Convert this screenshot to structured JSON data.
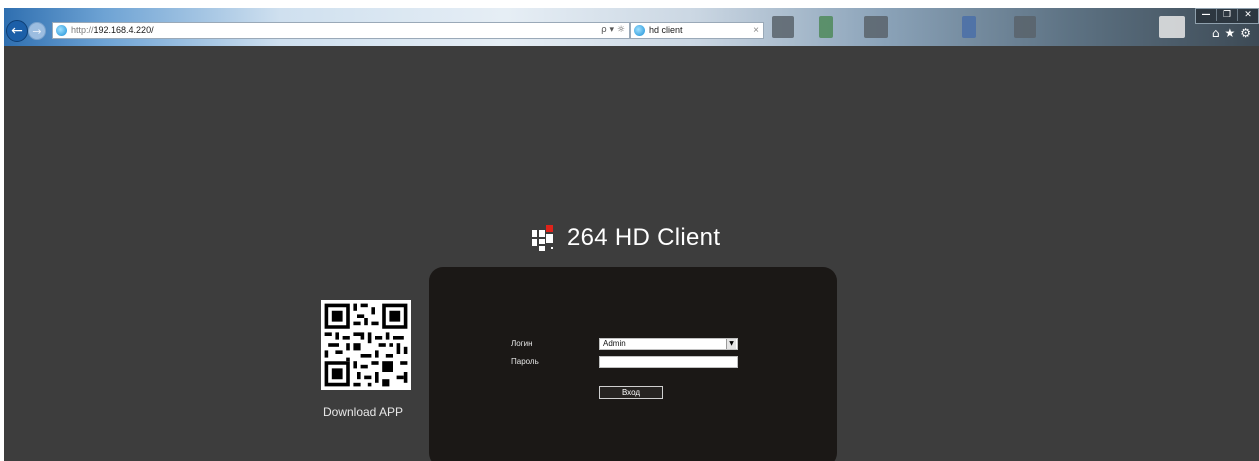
{
  "browser": {
    "url_scheme": "http://",
    "url_host": "192.168.4.220/",
    "address_tools": "ρ ▾ ☼",
    "tab_title": "hd client",
    "tab_close": "×",
    "back_glyph": "←",
    "forward_glyph": "→",
    "window_controls": {
      "minimize": "—",
      "restore": "❐",
      "close": "✕"
    },
    "toolbar": {
      "home": "⌂",
      "favorites": "★",
      "tools": "⚙"
    }
  },
  "page": {
    "title": "264 HD Client",
    "download_app": "Download APP",
    "login": {
      "login_label": "Логин",
      "login_value": "Admin",
      "password_label": "Пароль",
      "password_value": "",
      "submit_label": "Вход"
    }
  },
  "colors": {
    "background": "#3d3d3d",
    "panel": "#1b1816",
    "logo_accent": "#e0231a",
    "text": "#ffffff"
  }
}
